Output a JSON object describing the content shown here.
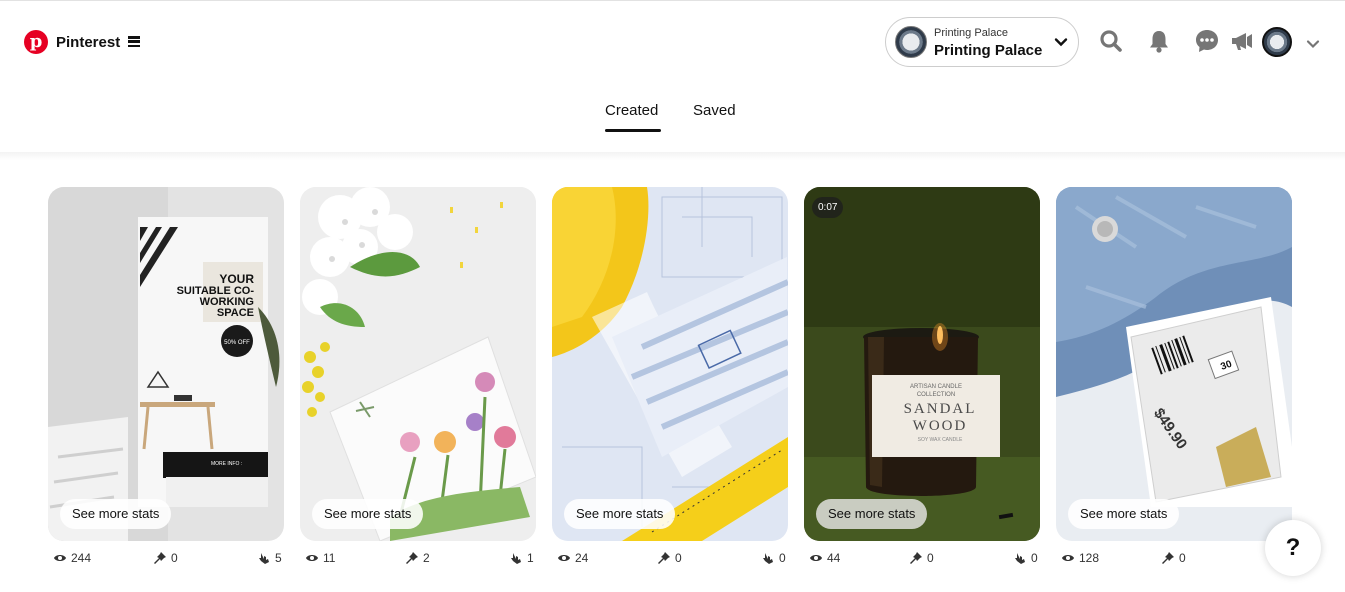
{
  "brand": {
    "name": "Pinterest",
    "logo_letter": "p"
  },
  "account": {
    "label": "Printing Palace",
    "name": "Printing Palace"
  },
  "header_icons": [
    "search-icon",
    "bell-icon",
    "messages-icon",
    "megaphone-icon"
  ],
  "tabs": [
    {
      "label": "Created",
      "active": true
    },
    {
      "label": "Saved",
      "active": false
    }
  ],
  "pins": [
    {
      "image": "coworking-banner",
      "stats_label": "See more stats",
      "views": "244",
      "saves": "0",
      "clicks": "5",
      "text_lines": [
        "YOUR",
        "SUITABLE CO-",
        "WORKING",
        "SPACE"
      ],
      "badge": "50% OFF",
      "footer": "MORE INFO :"
    },
    {
      "image": "floral-card",
      "stats_label": "See more stats",
      "views": "11",
      "saves": "2",
      "clicks": "1"
    },
    {
      "image": "blueprints-hardhat",
      "stats_label": "See more stats",
      "views": "24",
      "saves": "0",
      "clicks": "0"
    },
    {
      "image": "sandalwood-candle",
      "stats_label": "See more stats",
      "views": "44",
      "saves": "0",
      "clicks": "0",
      "duration": "0:07",
      "candle_lines": [
        "ARTISAN CANDLE",
        "COLLECTION",
        "SANDAL",
        "WOOD",
        "SOY WAX CANDLE"
      ]
    },
    {
      "image": "denim-price-tag",
      "stats_label": "See more stats",
      "views": "128",
      "saves": "0",
      "clicks": "0",
      "price": "$49.90",
      "tag_size": "30"
    }
  ],
  "help": {
    "label": "?"
  },
  "colors": {
    "brand_red": "#e60023",
    "text": "#111111",
    "candle_bg": "#3b4a1c"
  }
}
